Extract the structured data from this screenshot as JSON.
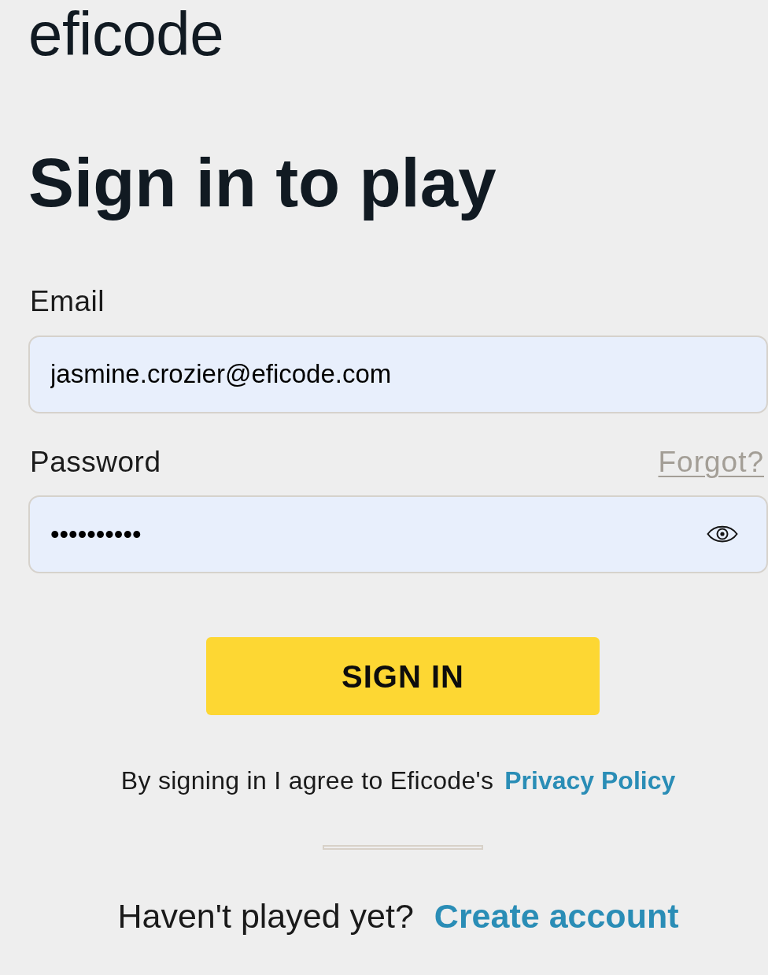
{
  "logo": {
    "text": "eficode"
  },
  "title": "Sign in to play",
  "fields": [
    {
      "kind": "email",
      "label": "Email",
      "value": "jasmine.crozier@eficode.com"
    },
    {
      "kind": "password",
      "label": "Password",
      "value": "••••••••••",
      "link": "Forgot?"
    }
  ],
  "submit_button": {
    "label": "SIGN IN"
  },
  "consent": {
    "text": "By signing in I agree to Eficode's",
    "link": "Privacy Policy"
  },
  "signup": {
    "text": "Haven't played yet?",
    "link": "Create account"
  }
}
